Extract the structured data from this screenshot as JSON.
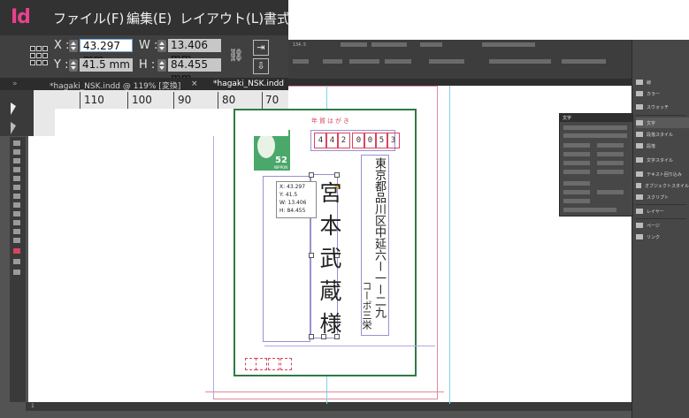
{
  "app": {
    "logo": "Id"
  },
  "menu": [
    "ファイル(F)",
    "編集(E)",
    "レイアウト(L)",
    "書式"
  ],
  "control": {
    "x_label": "X :",
    "x_value": "43.297 mm",
    "y_label": "Y :",
    "y_value": "41.5 mm",
    "w_label": "W :",
    "w_value": "13.406 mm",
    "h_label": "H :",
    "h_value": "84.455 mm"
  },
  "tabs": [
    {
      "label": "*hagaki_NSK.indd @ 119% [変換]",
      "close": "×"
    },
    {
      "label": "*hagaki_NSK.indd",
      "close": ""
    }
  ],
  "ruler": {
    "ticks": [
      "110",
      "100",
      "90",
      "80",
      "70"
    ]
  },
  "bg_control": {
    "zoom": "134.5"
  },
  "right_panel": {
    "items": [
      "線",
      "カラー",
      "スウォッチ",
      "文字",
      "段落スタイル",
      "段落",
      "文字スタイル",
      "テキスト回り込み",
      "オブジェクトスタイル",
      "スクリプト",
      "レイヤー",
      "ページ",
      "リンク"
    ]
  },
  "char_panel": {
    "title": "文字"
  },
  "status": {
    "page": "1"
  },
  "card": {
    "nenga": "年賀はがき",
    "stamp_value": "52",
    "stamp_name": "NIPPON",
    "zip": [
      "4",
      "4",
      "2",
      "0",
      "0",
      "5",
      "3"
    ],
    "address": [
      "東京都品川区中延六ー一ー二九",
      "コーポ三栄"
    ],
    "name": "宮本武蔵様"
  },
  "tooltip": [
    "X: 43.297",
    "Y: 41.5",
    "W: 13.406",
    "H: 84.455"
  ],
  "colors": {
    "brand": "#e8418d",
    "card_border": "#2f7a44",
    "zip_red": "#d8455d",
    "frame": "#9b8fd0"
  }
}
